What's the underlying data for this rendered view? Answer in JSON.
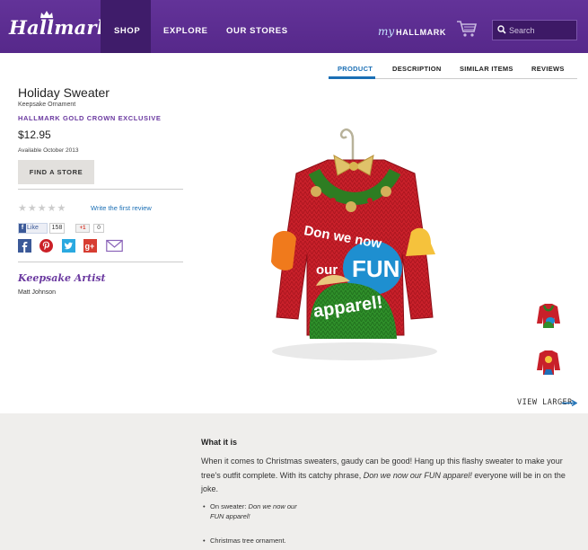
{
  "header": {
    "logo_text": "Hallmark",
    "nav": [
      "SHOP",
      "EXPLORE",
      "OUR STORES"
    ],
    "my_hallmark_prefix": "my",
    "my_hallmark_label": "HALLMARK",
    "search_placeholder": "Search",
    "brand_color": "#5c2d91"
  },
  "tabs": [
    "PRODUCT",
    "DESCRIPTION",
    "SIMILAR ITEMS",
    "REVIEWS"
  ],
  "product": {
    "title": "Holiday Sweater",
    "subtitle": "Keepsake Ornament",
    "exclusive": "HALLMARK GOLD CROWN EXCLUSIVE",
    "price": "$12.95",
    "availability": "Available October 2013",
    "find_store_label": "FIND A STORE",
    "review_link": "Write the first review",
    "rating_stars": 0,
    "fb_like_label": "Like",
    "fb_count": "158",
    "gplus_label": "+1",
    "gplus_count": "0",
    "artist_label": "Keepsake Artist",
    "artist_name": "Matt Johnson",
    "sweater_text": [
      "Don we now",
      "our",
      "FUN",
      "apparel!"
    ]
  },
  "view_larger": "VIEW LARGER",
  "what_it_is": {
    "heading": "What it is",
    "description_1": "When it comes to Christmas sweaters, gaudy can be good! Hang up this flashy sweater to make your tree's outfit complete. With its catchy phrase, ",
    "description_italic": "Don we now our FUN apparel!",
    "description_2": " everyone will be in on the joke.",
    "bullet_1_prefix": "On sweater: ",
    "bullet_1_italic": "Don we now our FUN apparel!",
    "bullet_2": "Christmas tree ornament."
  }
}
